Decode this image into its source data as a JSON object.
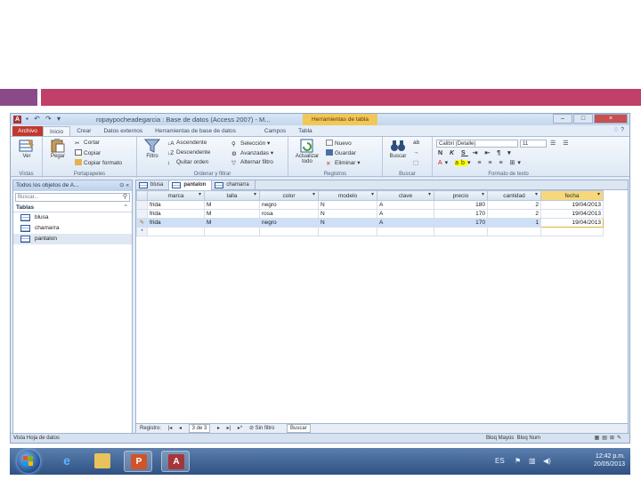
{
  "window": {
    "title": "ropaypocheadegarcia : Base de datos (Access 2007) - M...",
    "context_tab": "Herramientas de tabla",
    "minimize": "–",
    "maximize": "□",
    "close": "×"
  },
  "ribbon_tabs": [
    "Archivo",
    "Inicio",
    "Crear",
    "Datos externos",
    "Herramientas de base de datos",
    "Campos",
    "Tabla"
  ],
  "ribbon": {
    "vistas": {
      "ver": "Ver",
      "label": "Vistas"
    },
    "portapapeles": {
      "pegar": "Pegar",
      "cortar": "Cortar",
      "copiar": "Copiar",
      "copiar_formato": "Copiar formato",
      "label": "Portapapeles"
    },
    "ordenar": {
      "filtro": "Filtro",
      "ascendente": "Ascendente",
      "descendente": "Descendente",
      "quitar_orden": "Quitar orden",
      "seleccion": "Selección",
      "avanzadas": "Avanzadas",
      "alternar_filtro": "Alternar filtro",
      "label": "Ordenar y filtrar"
    },
    "registros": {
      "actualizar": "Actualizar todo",
      "nuevo": "Nuevo",
      "guardar": "Guardar",
      "eliminar": "Eliminar",
      "label": "Registros"
    },
    "buscar": {
      "buscar": "Buscar",
      "label": "Buscar"
    },
    "formato": {
      "font": "Calibri (Detalle)",
      "size": "11",
      "label": "Formato de texto"
    }
  },
  "nav": {
    "header": "Todos los objetos de A...",
    "search": "Buscar...",
    "group": "Tablas",
    "items": [
      "blusa",
      "chamarra",
      "pantalon"
    ]
  },
  "doc_tabs": [
    "blusa",
    "pantalon",
    "chamarra"
  ],
  "table": {
    "columns": [
      "marca",
      "talla",
      "color",
      "modelo",
      "clave",
      "precio",
      "cantidad",
      "fecha"
    ],
    "rows": [
      [
        "frida",
        "M",
        "negro",
        "N",
        "A",
        "180",
        "2",
        "19/04/2013"
      ],
      [
        "frida",
        "M",
        "rosa",
        "N",
        "A",
        "170",
        "2",
        "19/04/2013"
      ],
      [
        "frida",
        "M",
        "negro",
        "N",
        "A",
        "170",
        "1",
        "19/04/2013"
      ]
    ],
    "new_row_marker": "*",
    "edit_marker": "✎"
  },
  "record_nav": {
    "prefix": "Registro:",
    "position": "3 de 3",
    "filter": "Sin filtro",
    "search": "Buscar"
  },
  "status": {
    "left": "Vista Hoja de datos",
    "caps": "Bloq Mayús",
    "num": "Bloq Num"
  },
  "clock": {
    "time": "12:42 p.m.",
    "date": "20/05/2013"
  },
  "colors": {
    "accent_purple": "#8a4a89",
    "accent_pink": "#c1406a",
    "file_tab": "#c1382f",
    "context_tab": "#f1c75a"
  }
}
